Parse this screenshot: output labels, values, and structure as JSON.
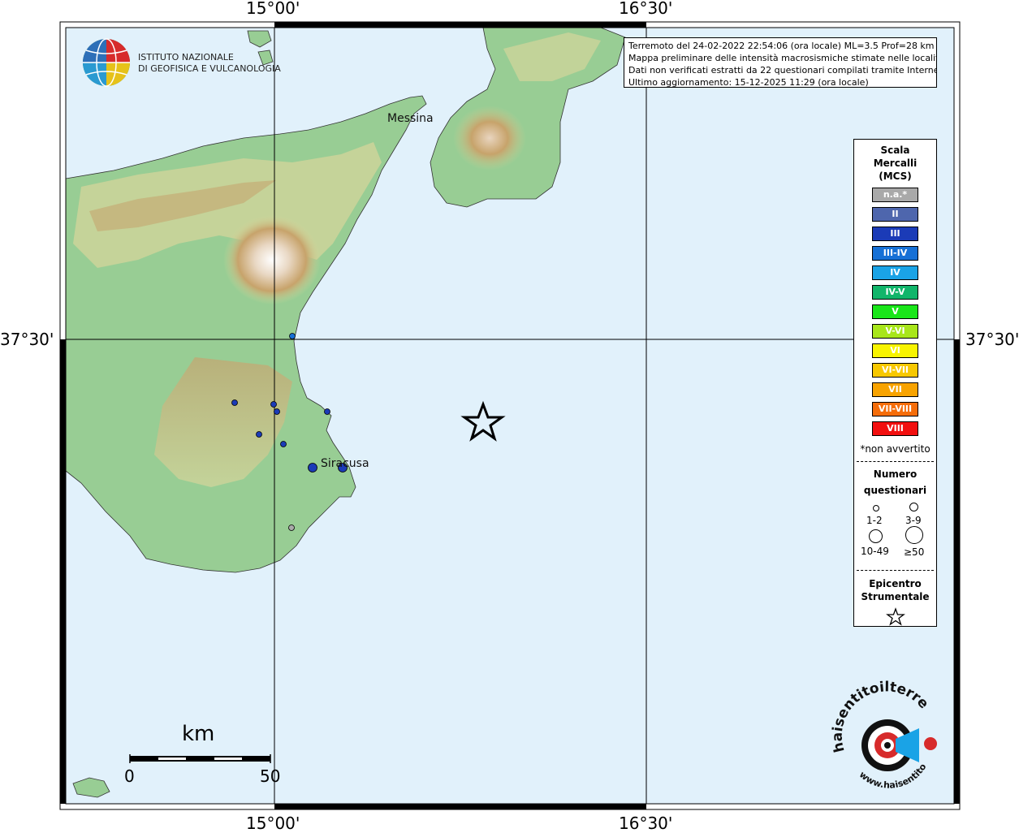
{
  "coordinates": {
    "lon_left": "15°00'",
    "lon_right": "16°30'",
    "lat_mid": "37°30'"
  },
  "logo": {
    "line1": "ISTITUTO NAZIONALE",
    "line2": "DI GEOFISICA E VULCANOLOGIA"
  },
  "info": {
    "line1": "Terremoto del 24-02-2022 22:54:06 (ora locale) ML=3.5 Prof=28 km",
    "line2": "Mappa preliminare delle intensità macrosismiche stimate nelle località",
    "line3": "Dati non verificati estratti da 22 questionari compilati tramite Internet.",
    "line4": "Ultimo aggiornamento: 15-12-2025 11:29 (ora locale)"
  },
  "places": {
    "messina": "Messina",
    "siracusa": "Siracusa"
  },
  "legend": {
    "title": [
      "Scala",
      "Mercalli",
      "(MCS)"
    ],
    "classes": [
      {
        "label": "n.a.*",
        "color": "#a9a9a9"
      },
      {
        "label": "II",
        "color": "#4e66ad"
      },
      {
        "label": "III",
        "color": "#1b3bb7"
      },
      {
        "label": "III-IV",
        "color": "#1670d6"
      },
      {
        "label": "IV",
        "color": "#1aa3e6"
      },
      {
        "label": "IV-V",
        "color": "#11b56a"
      },
      {
        "label": "V",
        "color": "#19e619"
      },
      {
        "label": "V-VI",
        "color": "#a8e61a"
      },
      {
        "label": "VI",
        "color": "#f8f400"
      },
      {
        "label": "VI-VII",
        "color": "#f8c800"
      },
      {
        "label": "VII",
        "color": "#f8a300"
      },
      {
        "label": "VII-VIII",
        "color": "#f56d0a"
      },
      {
        "label": "VIII",
        "color": "#f20f0f"
      }
    ],
    "note": "*non avvertito",
    "count_title": [
      "Numero",
      "questionari"
    ],
    "counts": [
      "1-2",
      "3-9",
      "10-49",
      "≥50"
    ],
    "epicenter_title": [
      "Epicentro",
      "Strumentale"
    ]
  },
  "scale": {
    "title": "km",
    "start": "0",
    "end": "50"
  },
  "badge": {
    "text_top": "haisentitoilterremoto.it",
    "text_bottom": "www.haisentitoilterremoto.it"
  },
  "colors": {
    "sea": "#e1f1fb",
    "land_low": "#8ec98e",
    "land_mid": "#dde3a8",
    "land_high": "#c9a36e",
    "frame": "#000000"
  },
  "observations": [
    {
      "name": "obs-1",
      "intensity": "III-IV",
      "count": "1-2"
    },
    {
      "name": "obs-2",
      "intensity": "III",
      "count": "1-2"
    },
    {
      "name": "obs-3",
      "intensity": "III",
      "count": "1-2"
    },
    {
      "name": "obs-4",
      "intensity": "III",
      "count": "1-2"
    },
    {
      "name": "obs-5",
      "intensity": "III",
      "count": "1-2"
    },
    {
      "name": "obs-6",
      "intensity": "III",
      "count": "1-2"
    },
    {
      "name": "obs-7",
      "intensity": "III",
      "count": "1-2"
    },
    {
      "name": "obs-siracusa-1",
      "intensity": "III",
      "count": "3-9"
    },
    {
      "name": "obs-siracusa-2",
      "intensity": "III",
      "count": "3-9"
    },
    {
      "name": "obs-na",
      "intensity": "n.a.*",
      "count": "1-2"
    }
  ]
}
